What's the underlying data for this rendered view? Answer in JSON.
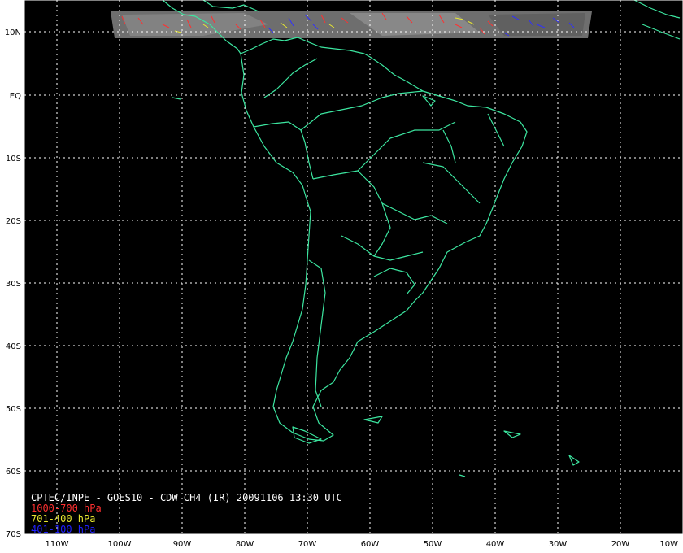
{
  "map": {
    "title": "CPTEC/INPE - GOES10 - CDW CH4 (IR) 20091106 13:30 UTC",
    "legend": [
      {
        "label": "1000-700 hPa",
        "color": "#ff3030"
      },
      {
        "label": "701-400 hPa",
        "color": "#e8e830"
      },
      {
        "label": "401-100 hPa",
        "color": "#2020ff"
      }
    ],
    "lat_labels": [
      "10N",
      "EQ",
      "10S",
      "20S",
      "30S",
      "40S",
      "50S",
      "60S",
      "70S"
    ],
    "lon_labels": [
      "110W",
      "100W",
      "90W",
      "80W",
      "70W",
      "60W",
      "50W",
      "40W",
      "30W",
      "20W",
      "10W"
    ],
    "colors": {
      "background": "#000000",
      "coastline": "#3ce6a0",
      "grid": "#ffffff",
      "frame": "#ffffff"
    }
  }
}
